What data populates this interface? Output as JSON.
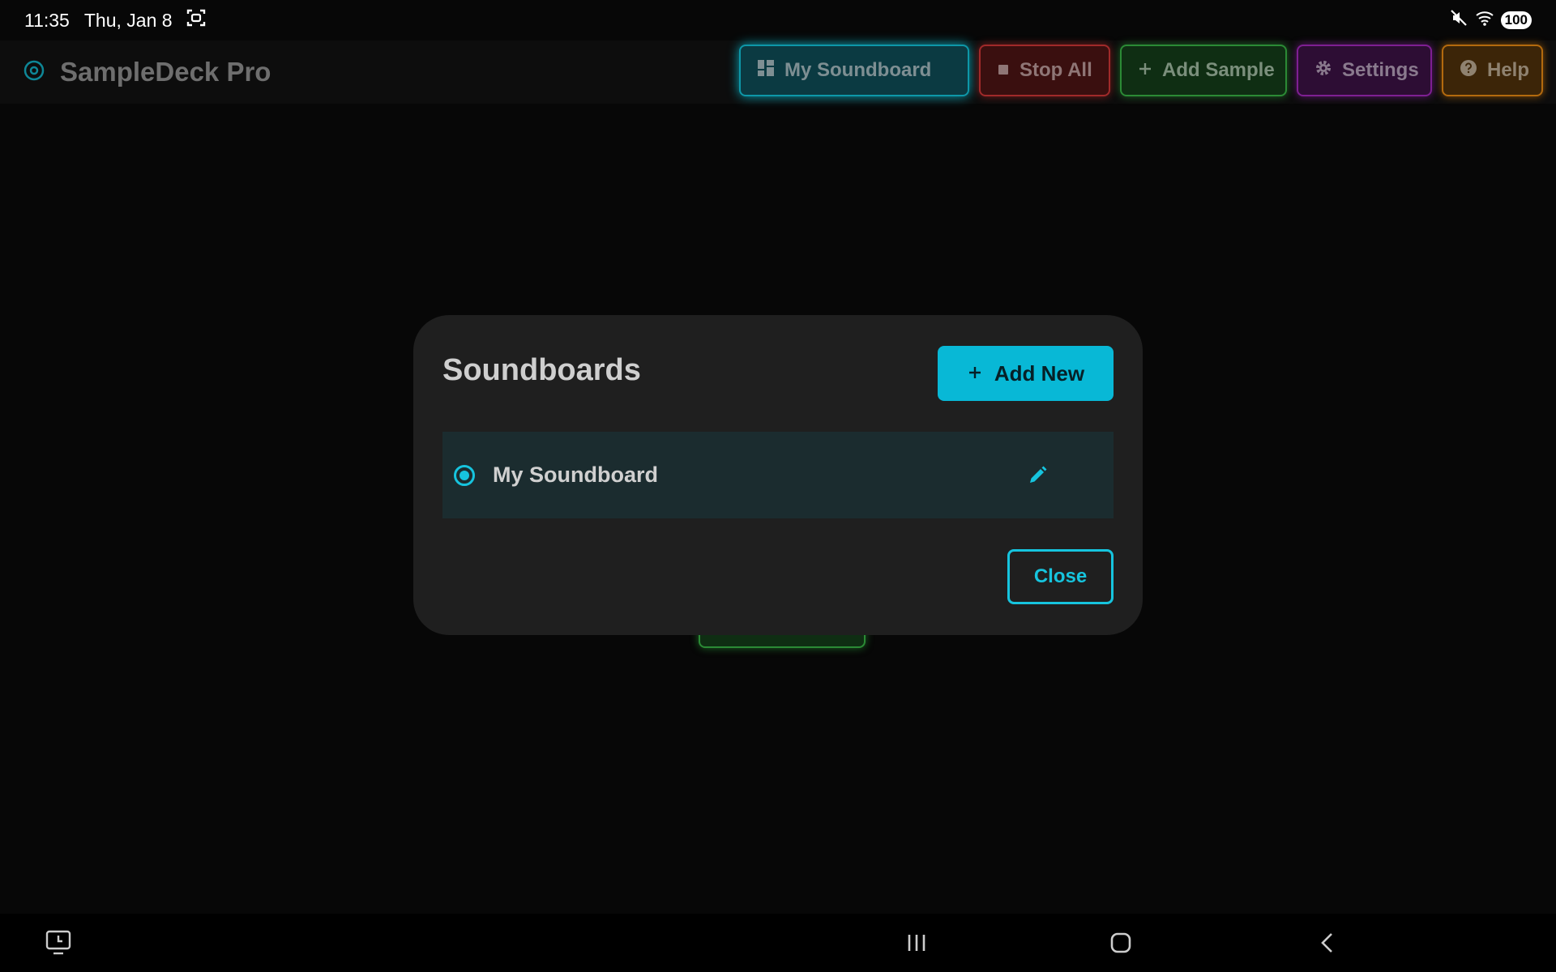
{
  "status_bar": {
    "time": "11:35",
    "date": "Thu, Jan 8",
    "battery": "100",
    "icons": [
      "screenshot-icon",
      "mute-icon",
      "wifi-icon",
      "battery-icon"
    ]
  },
  "app": {
    "title": "SampleDeck Pro",
    "logo_icon": "vinyl-icon"
  },
  "toolbar": {
    "soundboard_label": "My Soundboard",
    "stop_all_label": "Stop All",
    "add_sample_label": "Add Sample",
    "settings_label": "Settings",
    "help_label": "Help"
  },
  "dialog": {
    "title": "Soundboards",
    "add_new_label": "Add New",
    "items": [
      {
        "label": "My Soundboard",
        "selected": true
      }
    ],
    "close_label": "Close"
  },
  "colors": {
    "accent": "#08b8d6",
    "stop": "#a02a2a",
    "add": "#2b8a35",
    "settings": "#7e1f92",
    "help": "#b36a0e"
  },
  "nav_bar": {
    "icons": [
      "recent-apps-screen-icon",
      "recents-icon",
      "home-icon",
      "back-icon"
    ]
  }
}
